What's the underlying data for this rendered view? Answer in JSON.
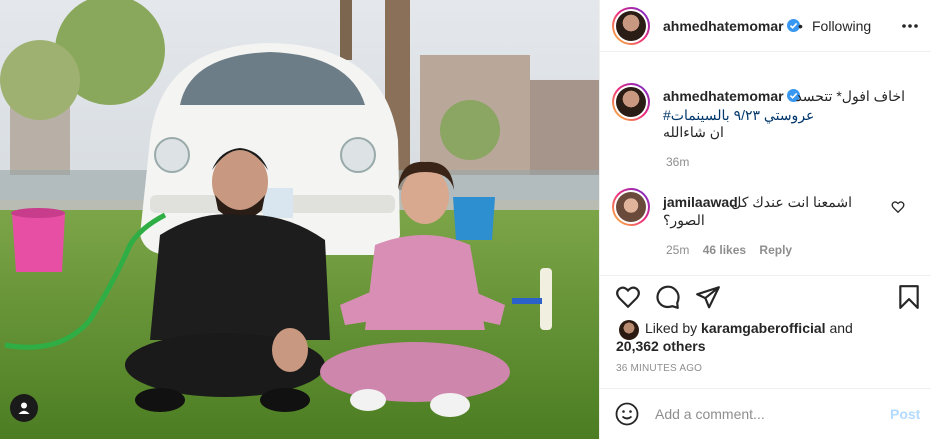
{
  "photo": {
    "alt_icon": "user-tag-icon",
    "colors": {
      "sky": "#d6dde3",
      "grass": "#5f8f2f",
      "car": "#f4f4f2",
      "pink": "#d98fb5",
      "black_outfit": "#1d1d1d",
      "bucket_pink": "#e64fa4",
      "bucket_blue": "#2d8fd0"
    }
  },
  "header": {
    "username": "ahmedhatemomar",
    "separator": "•",
    "follow_status": "Following",
    "more_icon": "more-horizontal-icon"
  },
  "caption": {
    "username": "ahmedhatemomar",
    "line1": "اخاف افول* تتحسد",
    "line2_hashtag": "عروستي ٩/٢٣ بالسينمات#",
    "line3": "ان شاءالله",
    "time": "36m"
  },
  "comment": {
    "username": "jamilaawad",
    "line1": "اشمعنا انت عندك كل",
    "line2": "الصور؟",
    "time": "25m",
    "likes": "46 likes",
    "reply": "Reply"
  },
  "actions": {
    "like_icon": "heart-icon",
    "comment_icon": "comment-icon",
    "share_icon": "share-icon",
    "save_icon": "bookmark-icon"
  },
  "likes": {
    "prefix": "Liked by",
    "liker": "karamgaberofficial",
    "and": "and",
    "others": "20,362 others"
  },
  "post_time": "36 MINUTES AGO",
  "add_comment": {
    "placeholder": "Add a comment...",
    "post_label": "Post",
    "emoji_icon": "emoji-icon"
  },
  "theme": {
    "link": "#00376b",
    "muted": "#8e8e8e",
    "post_disabled": "#b3dbff",
    "verified": "#3897f0"
  }
}
